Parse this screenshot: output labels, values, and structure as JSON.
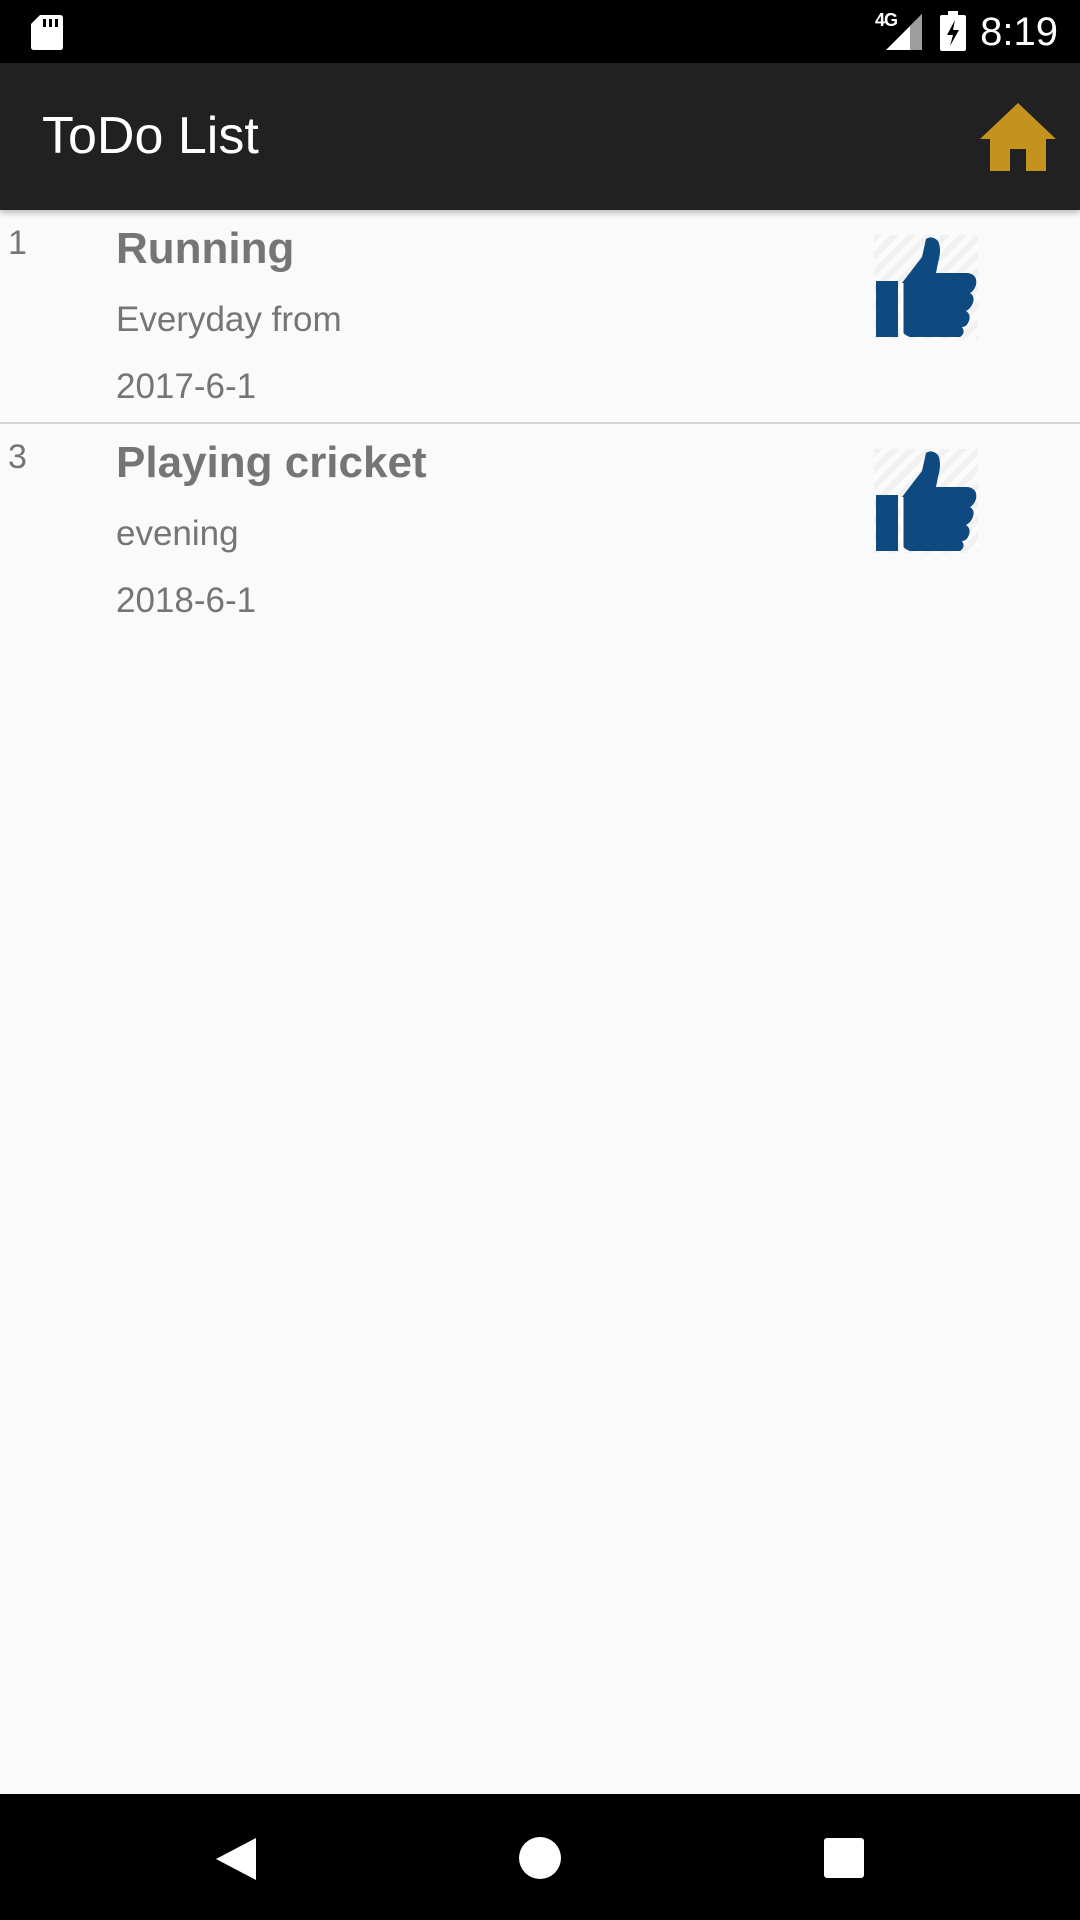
{
  "status_bar": {
    "network": "4G",
    "time": "8:19",
    "icons": [
      "sd-card-icon",
      "signal-icon",
      "battery-charging-icon"
    ]
  },
  "app_bar": {
    "title": "ToDo List",
    "home_icon": "home-icon",
    "accent_color": "#c4921e"
  },
  "todos": [
    {
      "number": "1",
      "title": "Running",
      "description": "Everyday from",
      "date": "2017-6-1",
      "icon": "thumbs-up-icon"
    },
    {
      "number": "3",
      "title": "Playing cricket",
      "description": "evening",
      "date": "2018-6-1",
      "icon": "thumbs-up-icon"
    }
  ],
  "nav_bar": {
    "icons": [
      "back-icon",
      "home-circle-icon",
      "recents-icon"
    ]
  },
  "colors": {
    "app_bar": "#212121",
    "background": "#fafafa",
    "text": "#757575",
    "thumb": "#0e4a80"
  }
}
